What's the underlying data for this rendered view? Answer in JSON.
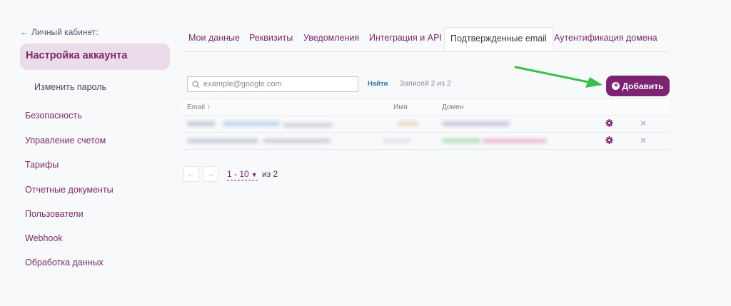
{
  "sidebar": {
    "back_label": "Личный кабинет:",
    "active_label": "Настройка аккаунта",
    "sub_item": "Изменить пароль",
    "items": [
      {
        "label": "Безопасность"
      },
      {
        "label": "Управление счетом"
      },
      {
        "label": "Тарифы"
      },
      {
        "label": "Отчетные документы"
      },
      {
        "label": "Пользователи"
      },
      {
        "label": "Webhook"
      },
      {
        "label": "Обработка данных"
      }
    ]
  },
  "tabs": [
    {
      "label": "Мои данные"
    },
    {
      "label": "Реквизиты"
    },
    {
      "label": "Уведомления"
    },
    {
      "label": "Интеграция и API"
    },
    {
      "label": "Подтвержденные email",
      "active": true
    },
    {
      "label": "Аутентификация домена"
    }
  ],
  "search": {
    "placeholder": "example@google.com",
    "value": ""
  },
  "find_label": "Найти",
  "records_text": "Записей 2 из 2",
  "add_button": {
    "label": "Добавить"
  },
  "table": {
    "columns": {
      "email": "Email ↑",
      "name": "Имя",
      "domain": "Домен"
    },
    "row_count": 2
  },
  "pager": {
    "range": "1 - 10",
    "of": "из 2"
  },
  "colors": {
    "accent": "#7c2472",
    "arrow": "#3cbe4a",
    "sidebar_active_bg": "#ecdbe9"
  }
}
